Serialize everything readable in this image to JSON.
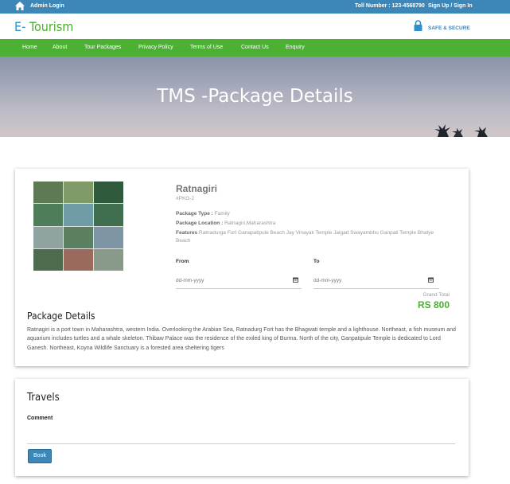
{
  "topbar": {
    "admin_login": "Admin Login",
    "toll_number": "Toll Number : 123-4568790",
    "signup": "Sign Up / Sign In",
    "icon": "home-icon"
  },
  "brand": {
    "logo_prefix": "E-",
    "logo_suffix": " Tourism",
    "secure_label": "SAFE & SECURE",
    "secure_icon": "lock-icon"
  },
  "nav": {
    "items": [
      "Home",
      "About",
      "Tour Packages",
      "Privacy Policy",
      "Terms of Use",
      "Contact Us",
      "Enquiry"
    ]
  },
  "hero": {
    "title": "TMS -Package Details"
  },
  "package": {
    "name": "Ratnagiri",
    "code": "#PKG-2",
    "type_label": "Package Type :",
    "type_value": "Family",
    "location_label": "Package Location :",
    "location_value": "Ratnagiri,Maharashtra",
    "features_label": "Features",
    "features_value": "Ratnadurga Fort Ganapatipule Beach Jay Vinayak Temple Jaigad Swayambhu Ganpati Temple Bhatye Beach",
    "from_label": "From",
    "to_label": "To",
    "from_placeholder": "dd-mm-yyyy",
    "to_placeholder": "dd-mm-yyyy",
    "grand_total_label": "Grand Total",
    "grand_total_value": "RS 800",
    "details_title": "Package Details",
    "details_text": "Ratnagiri is a port town in Maharashtra, western India. Overlooking the Arabian Sea, Ratnadurg Fort has the Bhagwati temple and a lighthouse. Northeast, a fish museum and aquarium includes turtles and a whale skeleton. Thibaw Palace was the residence of the exiled king of Burma. North of the city, Ganpatipule Temple is dedicated to Lord Ganesh. Northeast, Koyna Wildlife Sanctuary is a forested area sheltering tigers"
  },
  "travels": {
    "title": "Travels",
    "comment_label": "Comment",
    "book_label": "Book"
  },
  "colors": {
    "topbar": "#3d87b8",
    "nav": "#4cb133",
    "accent_green": "#4caf2f",
    "button": "#3d87b8"
  }
}
